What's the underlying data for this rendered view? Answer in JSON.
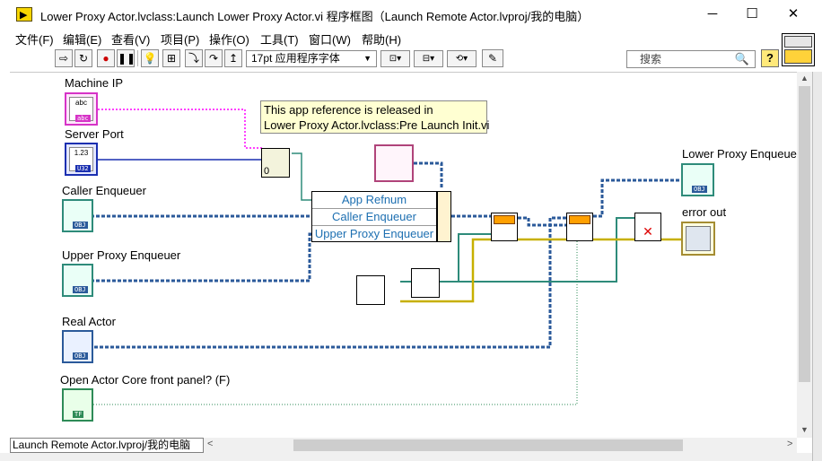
{
  "window": {
    "title": "Lower Proxy Actor.lvclass:Launch Lower Proxy Actor.vi 程序框图（Launch Remote Actor.lvproj/我的电脑）",
    "controls": {
      "minimize": "─",
      "maximize": "☐",
      "close": "✕"
    }
  },
  "menu": [
    "文件(F)",
    "编辑(E)",
    "查看(V)",
    "项目(P)",
    "操作(O)",
    "工具(T)",
    "窗口(W)",
    "帮助(H)"
  ],
  "toolbar": {
    "font": "17pt 应用程序字体",
    "search_placeholder": "搜索",
    "help": "?"
  },
  "diagram": {
    "labels": {
      "machine_ip": "Machine IP",
      "server_port": "Server Port",
      "caller_enqueuer": "Caller Enqueuer",
      "upper_proxy_enqueuer": "Upper Proxy Enqueuer",
      "real_actor": "Real Actor",
      "open_front_panel": "Open Actor Core front panel? (F)",
      "lower_proxy_enqueuer": "Lower Proxy Enqueuer",
      "error_out": "error out"
    },
    "terminal_text": {
      "abc": "abc",
      "abc_tag": "abc",
      "num": "1.23",
      "num_tag": "U32",
      "tf_tag": "TF",
      "obj_tag": "OBJ",
      "zero": "0"
    },
    "note": [
      "This app reference is released in",
      "Lower Proxy Actor.lvclass:Pre Launch Init.vi"
    ],
    "bundle_fields": [
      "App Refnum",
      "Caller Enqueuer",
      "Upper Proxy Enqueuer"
    ]
  },
  "statusbar": {
    "path": "Launch Remote Actor.lvproj/我的电脑"
  },
  "colors": {
    "string_wire": "#ff00ff",
    "numeric_wire": "#1a2fb0",
    "class_wire": "#2b5a9a",
    "refnum_wire": "#2e8b7a",
    "error_wire": "#c7b000",
    "boolean_wire": "#2e8b57"
  }
}
